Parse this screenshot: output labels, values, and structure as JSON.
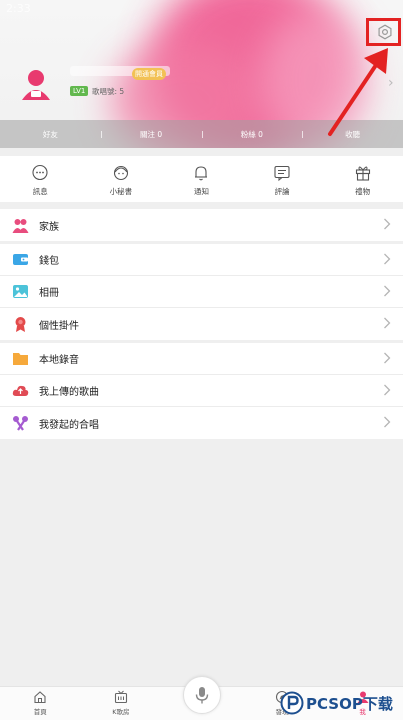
{
  "status_bar": {
    "time": "2:33"
  },
  "profile": {
    "song_id_label": "歌唱號: 5",
    "level_badge": "LV1",
    "vip_badge": "開通會員"
  },
  "stats": [
    {
      "label": "好友"
    },
    {
      "label": "關注 0"
    },
    {
      "label": "粉絲 0"
    },
    {
      "label": "收聽"
    }
  ],
  "quick_actions": [
    {
      "label": "訊息",
      "icon": "chat-bubble-icon"
    },
    {
      "label": "小秘書",
      "icon": "assistant-icon"
    },
    {
      "label": "通知",
      "icon": "bell-icon"
    },
    {
      "label": "評論",
      "icon": "comment-icon"
    },
    {
      "label": "禮物",
      "icon": "gift-icon"
    }
  ],
  "menu_groups": [
    [
      {
        "label": "家族",
        "icon": "family-icon"
      }
    ],
    [
      {
        "label": "錢包",
        "icon": "wallet-icon"
      },
      {
        "label": "相冊",
        "icon": "album-icon"
      },
      {
        "label": "個性掛件",
        "icon": "badge-icon"
      }
    ],
    [
      {
        "label": "本地錄音",
        "icon": "folder-icon"
      },
      {
        "label": "我上傳的歌曲",
        "icon": "cloud-upload-icon"
      },
      {
        "label": "我發起的合唱",
        "icon": "duet-icon"
      }
    ]
  ],
  "bottom_nav": [
    {
      "label": "首頁",
      "icon": "home-icon"
    },
    {
      "label": "K歌房",
      "icon": "ktv-room-icon"
    },
    {
      "label": "",
      "icon": "mic-icon"
    },
    {
      "label": "發現",
      "icon": "discover-icon"
    },
    {
      "label": "我",
      "icon": "me-icon"
    }
  ],
  "watermark": {
    "text": "PCSOP下载"
  },
  "colors": {
    "accent": "#f0508a",
    "highlight": "#e32222"
  }
}
